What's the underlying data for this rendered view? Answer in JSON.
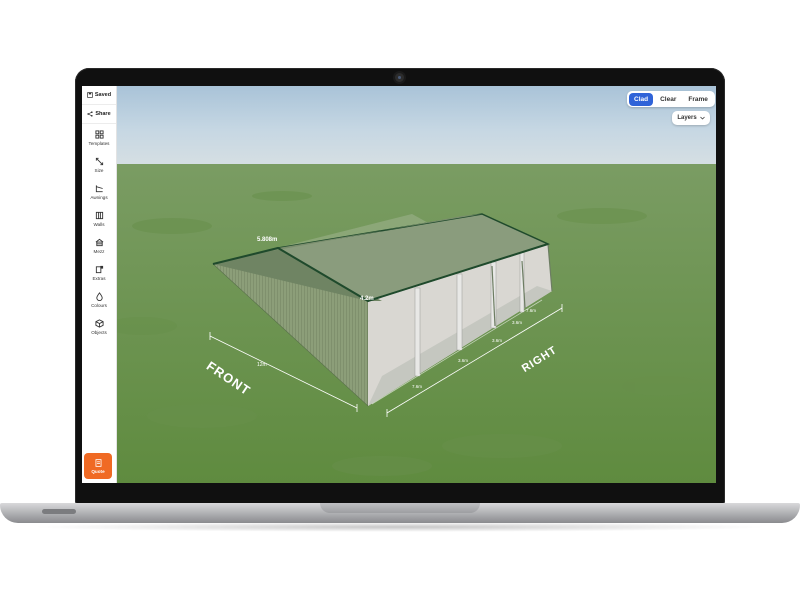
{
  "sidebar": {
    "saved_label": "Saved",
    "share_label": "Share",
    "items": [
      {
        "label": "Templates",
        "icon": "grid-icon"
      },
      {
        "label": "Size",
        "icon": "resize-icon"
      },
      {
        "label": "Awnings",
        "icon": "awning-icon"
      },
      {
        "label": "Walls",
        "icon": "walls-icon"
      },
      {
        "label": "Mezz",
        "icon": "mezzanine-icon"
      },
      {
        "label": "Extras",
        "icon": "extras-icon"
      },
      {
        "label": "Colours",
        "icon": "droplet-icon"
      },
      {
        "label": "Objects",
        "icon": "cube-icon"
      }
    ],
    "quote_label": "Quote"
  },
  "view_switch": {
    "options": [
      "Clad",
      "Clear",
      "Frame"
    ],
    "selected": "Clad"
  },
  "layers": {
    "label": "Layers"
  },
  "scene": {
    "labels": {
      "front": "FRONT",
      "right": "RIGHT",
      "front_width": "12m",
      "roof_span": "5.808m",
      "wall_height": "4.2m",
      "bay_1": "7.6m",
      "bay_2": "3.6m",
      "bay_3": "3.6m",
      "bay_4": "3.6m",
      "bay_5": "7.6m"
    },
    "colors": {
      "roof": "#7e9473",
      "trim": "#1f4a2c",
      "wall": "#8fa07c",
      "grass": "#6f9652"
    }
  }
}
